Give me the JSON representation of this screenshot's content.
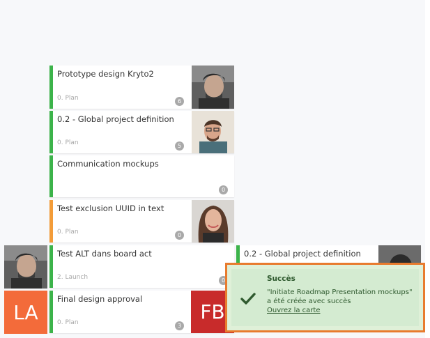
{
  "cards": [
    {
      "title": "Prototype design Kryto2",
      "list": "0. Plan",
      "count": "6",
      "strip": "#3cb34a"
    },
    {
      "title": "0.2 - Global project definition",
      "list": "0. Plan",
      "count": "5",
      "strip": "#3cb34a"
    },
    {
      "title": "Communication mockups",
      "list": "",
      "count": "0",
      "strip": "#3cb34a"
    },
    {
      "title": "Test exclusion UUID in text",
      "list": "0. Plan",
      "count": "0",
      "strip": "#f39c39"
    },
    {
      "title": "Test ALT dans board act",
      "list": "2. Launch",
      "count": "0",
      "strip": "#3cb34a"
    },
    {
      "title": "Final design approval",
      "list": "0. Plan",
      "count": "3",
      "strip": "#3cb34a"
    },
    {
      "title": "0.2 - Global project definition",
      "list": "",
      "count": "",
      "strip": "#3cb34a"
    }
  ],
  "avatars": {
    "la_initials": "LA",
    "la_color": "#f36b3a",
    "fb_initials": "FB",
    "fb_color": "#c82b2b"
  },
  "toast": {
    "title": "Succès",
    "message": "\"Initiate Roadmap Presentation mockups\" a été créée avec succès",
    "link": "Ouvrez la carte",
    "icon": "checkmark-icon",
    "border_color": "#e87b2e",
    "bg_color": "#d4ebd1"
  }
}
